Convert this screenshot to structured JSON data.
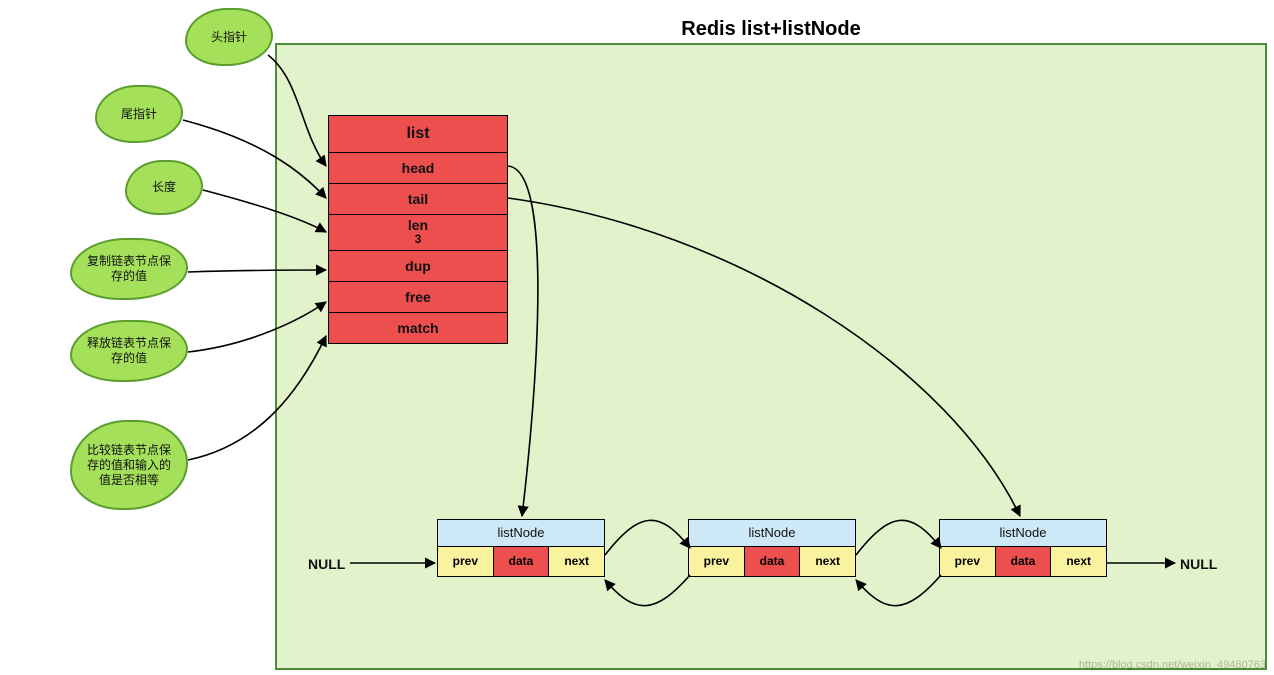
{
  "title": "Redis list+listNode",
  "struct": {
    "header": "list",
    "rows": {
      "head": "head",
      "tail": "tail",
      "len_label": "len",
      "len_value": "3",
      "dup": "dup",
      "free": "free",
      "match": "match"
    }
  },
  "clouds": {
    "c1": "头指针",
    "c2": "尾指针",
    "c3": "长度",
    "c4": "复制链表节点保存的值",
    "c5": "释放链表节点保存的值",
    "c6": "比较链表节点保存的值和输入的值是否相等"
  },
  "node": {
    "header": "listNode",
    "prev": "prev",
    "data": "data",
    "next": "next"
  },
  "null_left": "NULL",
  "null_right": "NULL",
  "watermark": "https://blog.csdn.net/weixin_49480763"
}
